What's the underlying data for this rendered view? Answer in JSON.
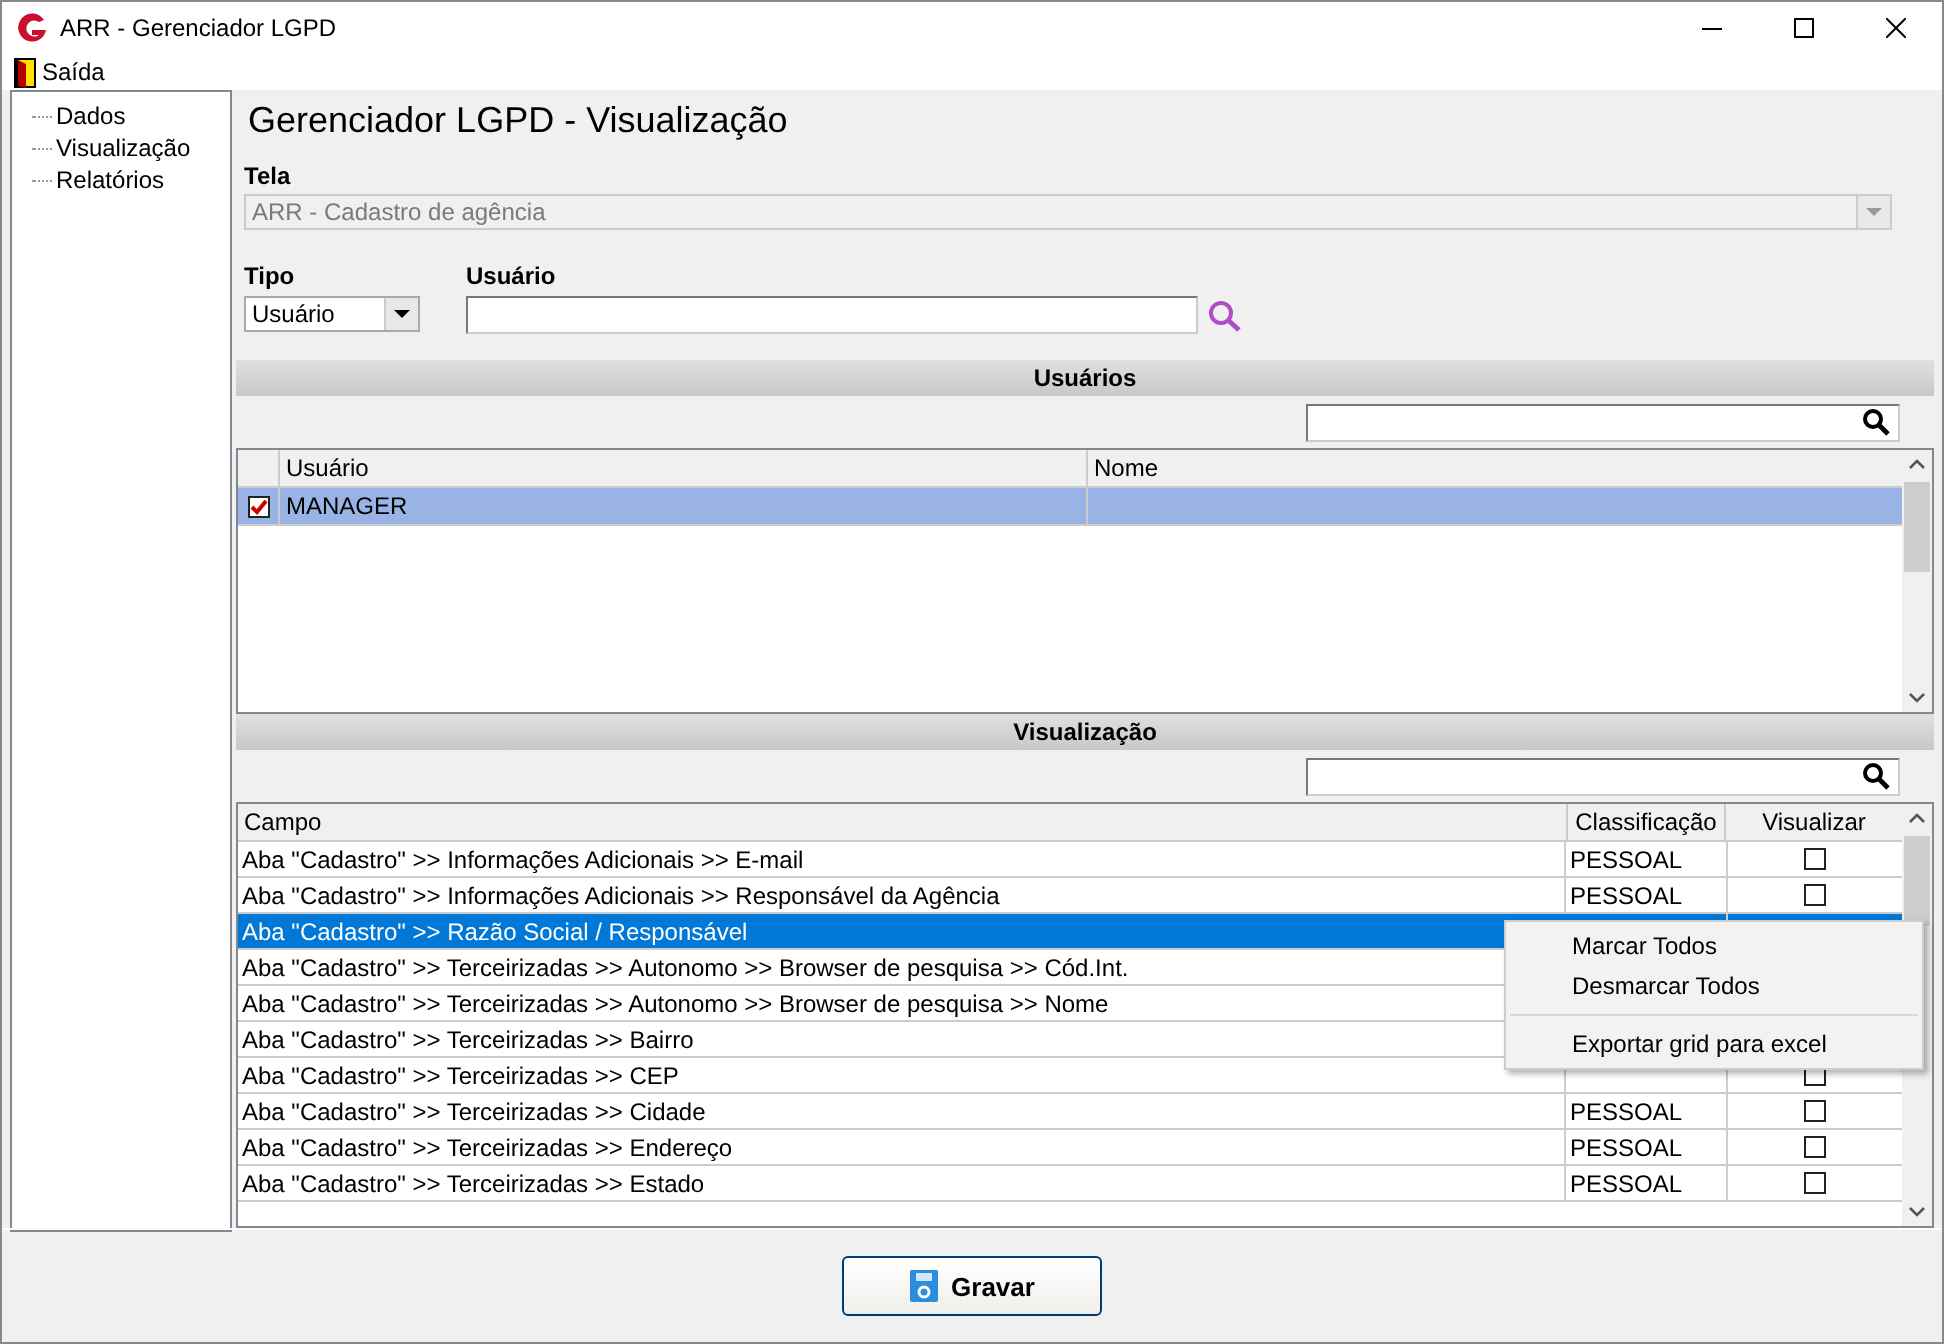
{
  "window": {
    "title": "ARR - Gerenciador LGPD"
  },
  "menu": [
    {
      "label": "Saída"
    }
  ],
  "tree": {
    "items": [
      {
        "label": "Dados"
      },
      {
        "label": "Visualização"
      },
      {
        "label": "Relatórios"
      }
    ]
  },
  "heading": "Gerenciador LGPD - Visualização",
  "tela": {
    "label": "Tela",
    "value": "ARR - Cadastro de agência",
    "disabled": true
  },
  "tipo": {
    "label": "Tipo",
    "value": "Usuário"
  },
  "usuario": {
    "label": "Usuário"
  },
  "usuarios": {
    "title": "Usuários",
    "columns": [
      "Usuário",
      "Nome"
    ],
    "rows": [
      {
        "checked": true,
        "selected": true,
        "usuario": "MANAGER"
      }
    ]
  },
  "visualizacao": {
    "title": "Visualização",
    "columns": [
      "Campo",
      "Classificação",
      "Visualizar"
    ],
    "rows": [
      {
        "campo": "Aba \"Cadastro\" >> Informações Adicionais >> E-mail",
        "classificacao": "PESSOAL",
        "visualizar": false,
        "selected": false
      },
      {
        "campo": "Aba \"Cadastro\" >> Informações Adicionais >> Responsável da Agência",
        "classificacao": "PESSOAL",
        "visualizar": false,
        "selected": false
      },
      {
        "campo": "Aba \"Cadastro\" >> Razão Social / Responsável",
        "selected": true
      },
      {
        "campo": "Aba \"Cadastro\" >> Terceirizadas >> Autonomo >> Browser de pesquisa >> Cód.Int.",
        "selected": false
      },
      {
        "campo": "Aba \"Cadastro\" >> Terceirizadas >> Autonomo >> Browser de pesquisa >> Nome",
        "selected": false
      },
      {
        "campo": "Aba \"Cadastro\" >> Terceirizadas >> Bairro",
        "selected": false
      },
      {
        "campo": "Aba \"Cadastro\" >> Terceirizadas >> CEP",
        "visualizar": false,
        "selected": false
      },
      {
        "campo": "Aba \"Cadastro\" >> Terceirizadas >> Cidade",
        "classificacao": "PESSOAL",
        "visualizar": false,
        "selected": false
      },
      {
        "campo": "Aba \"Cadastro\" >> Terceirizadas >> Endereço",
        "classificacao": "PESSOAL",
        "visualizar": false,
        "selected": false
      },
      {
        "campo": "Aba \"Cadastro\" >> Terceirizadas >> Estado",
        "classificacao": "PESSOAL",
        "visualizar": false,
        "selected": false
      }
    ]
  },
  "context_menu": {
    "items": [
      {
        "label": "Marcar Todos",
        "separator_before": false
      },
      {
        "label": "Desmarcar Todos",
        "separator_before": false
      },
      {
        "label": "Exportar grid para excel",
        "separator_before": true
      }
    ]
  },
  "buttons": [
    {
      "label": "Gravar"
    }
  ]
}
